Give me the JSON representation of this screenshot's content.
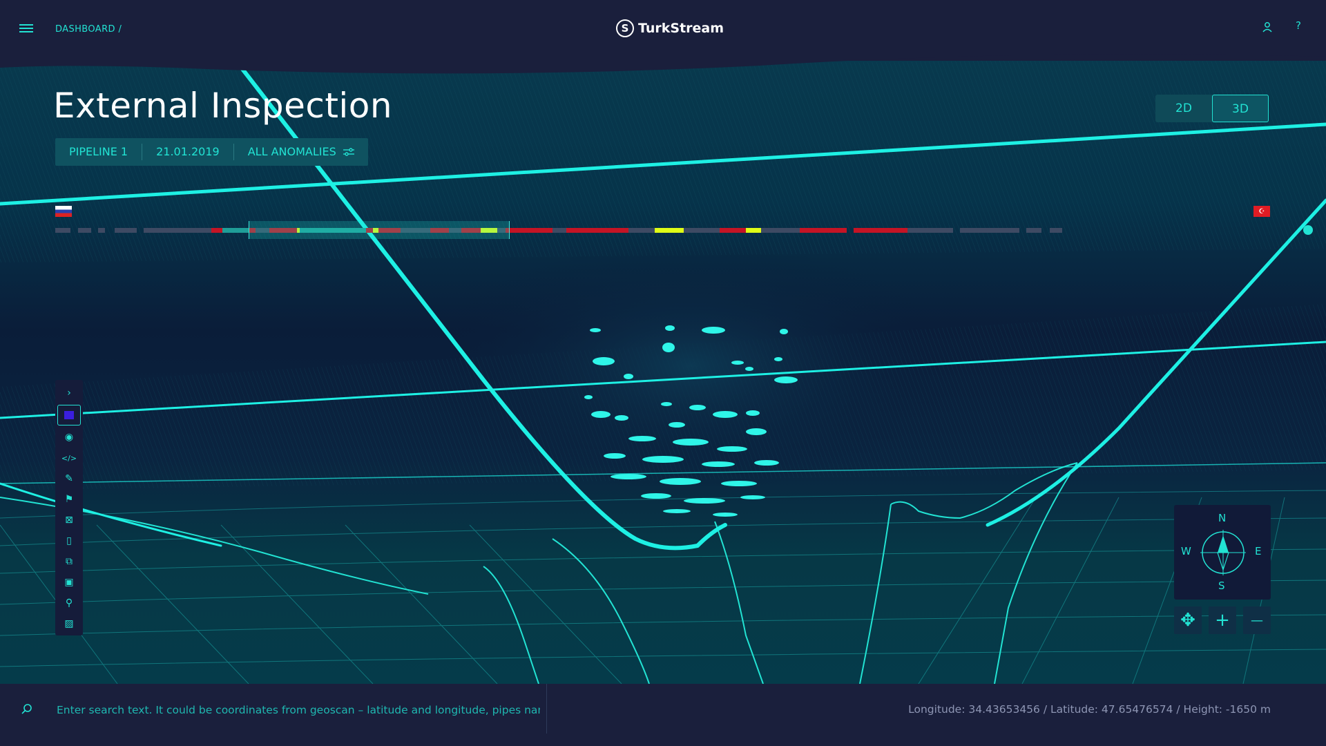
{
  "header": {
    "breadcrumb": "DASHBOARD  /",
    "logo_text": "TurkStream",
    "logo_mark": "S",
    "help_label": "?",
    "icons": {
      "menu": "hamburger-icon",
      "user": "user-icon",
      "help": "help-icon"
    }
  },
  "page": {
    "title": "External Inspection",
    "filters": [
      {
        "label": "PIPELINE 1"
      },
      {
        "label": "21.01.2019"
      },
      {
        "label": "ALL ANOMALIES",
        "icon": "sliders-icon"
      }
    ],
    "view_modes": [
      {
        "label": "2D",
        "active": false
      },
      {
        "label": "3D",
        "active": true
      }
    ]
  },
  "route": {
    "start_flag": "russia-flag",
    "end_flag": "turkey-flag",
    "colors": {
      "normal": "#3e4a63",
      "anomaly": "#c41425",
      "warning": "#dffd16",
      "selected": "#1f9e98"
    }
  },
  "toolbar": {
    "tools": [
      {
        "name": "expand-tool",
        "icon": "chevron-right-icon",
        "active": false
      },
      {
        "name": "layer-tool",
        "icon": "cube-icon",
        "active": true
      },
      {
        "name": "visibility-tool",
        "icon": "eye-icon",
        "active": false
      },
      {
        "name": "code-tool",
        "icon": "code-icon",
        "active": false
      },
      {
        "name": "ruler-tool",
        "icon": "ruler-icon",
        "active": false
      },
      {
        "name": "marker-tool",
        "icon": "flag-icon",
        "active": false
      },
      {
        "name": "area-tool",
        "icon": "area-icon",
        "active": false
      },
      {
        "name": "cylinder-tool",
        "icon": "cylinder-icon",
        "active": false
      },
      {
        "name": "objects-tool",
        "icon": "objects-icon",
        "active": false
      },
      {
        "name": "terrain-tool",
        "icon": "terrain-icon",
        "active": false
      },
      {
        "name": "branch-tool",
        "icon": "branch-icon",
        "active": false
      },
      {
        "name": "image-tool",
        "icon": "image-icon",
        "active": false
      }
    ]
  },
  "compass": {
    "n": "N",
    "s": "S",
    "e": "E",
    "w": "W"
  },
  "nav_controls": [
    {
      "name": "pan-button",
      "symbol": "✥"
    },
    {
      "name": "zoom-in-button",
      "symbol": "+"
    },
    {
      "name": "zoom-out-button",
      "symbol": "—"
    }
  ],
  "footer": {
    "search_placeholder": "Enter search text. It could be coordinates from geoscan – latitude and longitude, pipes name.",
    "coordinates": "Longitude: 34.43653456 / Latitude: 47.65476574 / Height: -1650 m"
  },
  "scene": {
    "accent": "#22e3d3",
    "line_color": "#1ef0e4"
  }
}
